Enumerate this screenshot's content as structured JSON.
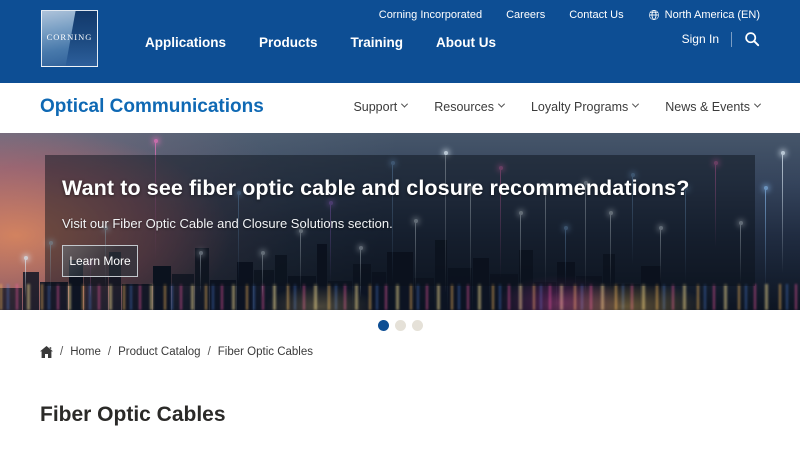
{
  "header": {
    "logo_text": "CORNING",
    "utility_links": [
      "Corning Incorporated",
      "Careers",
      "Contact Us"
    ],
    "locale": "North America (EN)",
    "main_nav": [
      "Applications",
      "Products",
      "Training",
      "About Us"
    ],
    "sign_in_label": "Sign In"
  },
  "subheader": {
    "title": "Optical Communications",
    "menus": [
      "Support",
      "Resources",
      "Loyalty Programs",
      "News & Events"
    ]
  },
  "hero": {
    "headline": "Want to see fiber optic cable and closure recommendations?",
    "subtext": "Visit our Fiber Optic Cable and Closure Solutions section.",
    "cta_label": "Learn More",
    "slide_count": 3,
    "active_slide": 0
  },
  "breadcrumb": {
    "items": [
      "Home",
      "Product Catalog",
      "Fiber Optic Cables"
    ]
  },
  "page": {
    "title": "Fiber Optic Cables"
  },
  "colors": {
    "header_blue": "#0d4e94",
    "brand_link_blue": "#0f69b4",
    "dot_active": "#0d4e94",
    "dot_inactive": "#e5e1d8"
  }
}
